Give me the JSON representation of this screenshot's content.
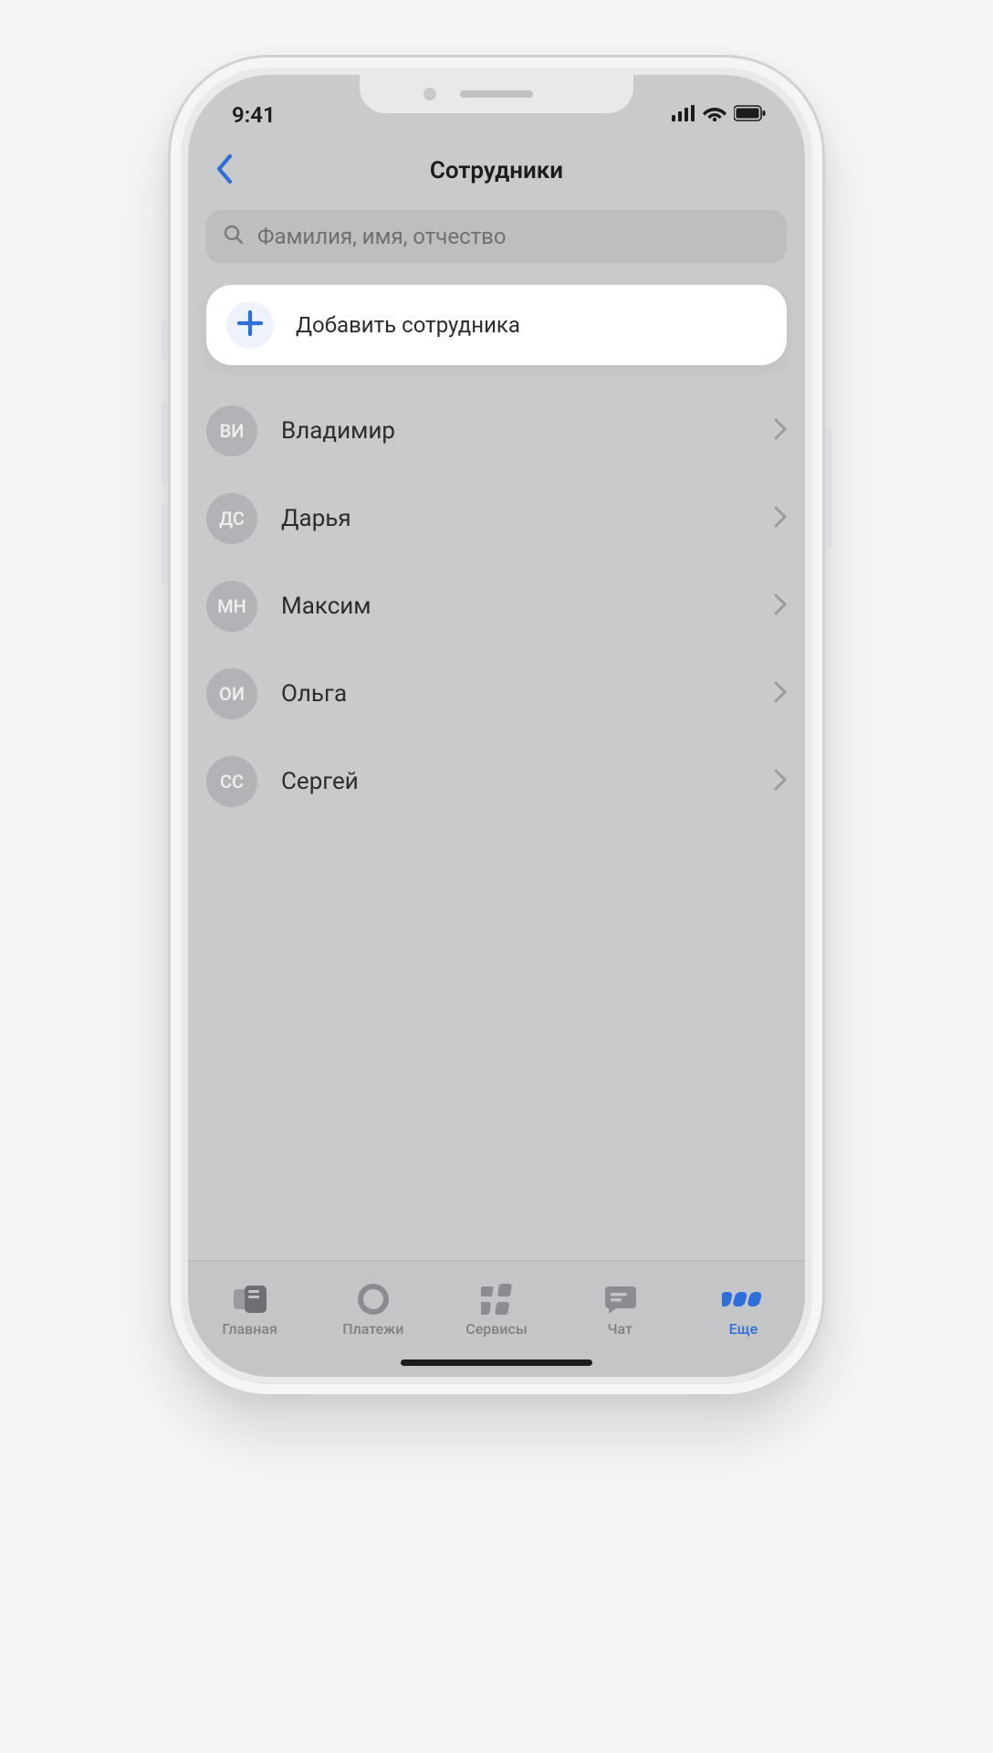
{
  "status": {
    "time": "9:41"
  },
  "header": {
    "title": "Сотрудники"
  },
  "search": {
    "placeholder": "Фамилия, имя, отчество"
  },
  "add": {
    "label": "Добавить сотрудника"
  },
  "employees": [
    {
      "initials": "ВИ",
      "name": "Владимир"
    },
    {
      "initials": "ДС",
      "name": "Дарья"
    },
    {
      "initials": "МН",
      "name": "Максим"
    },
    {
      "initials": "ОИ",
      "name": "Ольга"
    },
    {
      "initials": "СС",
      "name": "Сергей"
    }
  ],
  "tabs": [
    {
      "label": "Главная",
      "active": false
    },
    {
      "label": "Платежи",
      "active": false
    },
    {
      "label": "Сервисы",
      "active": false
    },
    {
      "label": "Чат",
      "active": false
    },
    {
      "label": "Еще",
      "active": true
    }
  ],
  "colors": {
    "accent": "#2f6fd9"
  }
}
